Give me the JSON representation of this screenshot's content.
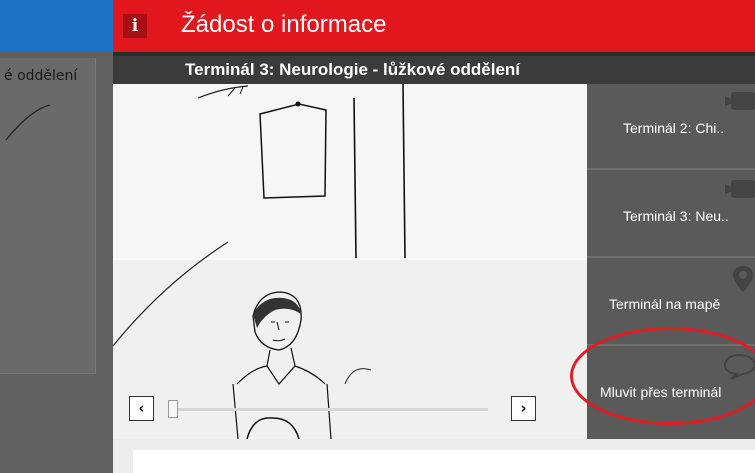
{
  "background": {
    "label": "é oddělení"
  },
  "modal": {
    "icon_glyph": "i",
    "title": "Žádost o informace",
    "subtitle": "Terminál 3: Neurologie - lůžkové oddělení"
  },
  "video": {
    "prev_glyph": "‹",
    "next_glyph": "›",
    "progress": 0.0
  },
  "sidebar": {
    "items": [
      {
        "label": "Terminál 2: Chi..",
        "icon": "video-camera-icon"
      },
      {
        "label": "Terminál 3: Neu..",
        "icon": "video-camera-icon"
      },
      {
        "label": "Terminál na mapě",
        "icon": "map-pin-icon"
      },
      {
        "label": "Mluvit přes terminál",
        "icon": "speech-bubble-icon"
      }
    ]
  },
  "colors": {
    "header_red": "#e2171e",
    "app_blue": "#1e73c6",
    "sidebar_gray": "#5a5a5a",
    "highlight_red": "#e31b23"
  }
}
